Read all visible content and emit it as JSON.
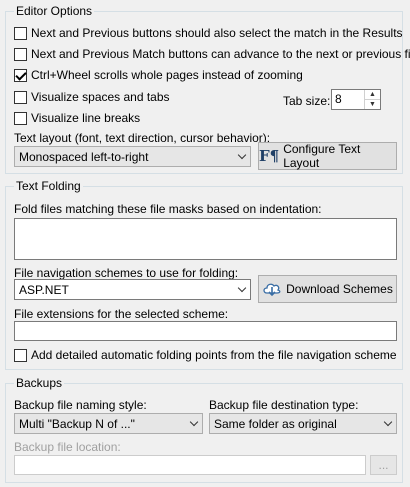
{
  "editor_options": {
    "title": "Editor Options",
    "cb_next_prev_select": {
      "label": "Next and Previous buttons should also select the match in the Results",
      "checked": false
    },
    "cb_next_prev_advance": {
      "label": "Next and Previous Match buttons can advance to the next or previous file",
      "checked": false
    },
    "cb_ctrl_wheel": {
      "label": "Ctrl+Wheel scrolls whole pages instead of zooming",
      "checked": true
    },
    "cb_visualize_spaces": {
      "label": "Visualize spaces and tabs",
      "checked": false
    },
    "cb_visualize_linebreaks": {
      "label": "Visualize line breaks",
      "checked": false
    },
    "tab_size_label": "Tab size:",
    "tab_size_value": "8",
    "text_layout_label": "Text layout (font, text direction, cursor behavior):",
    "text_layout_value": "Monospaced left-to-right",
    "configure_button": "Configure Text Layout"
  },
  "text_folding": {
    "title": "Text Folding",
    "masks_label": "Fold files matching these file masks based on indentation:",
    "masks_value": "",
    "schemes_label": "File navigation schemes to use for folding:",
    "schemes_value": "ASP.NET",
    "download_button": "Download Schemes",
    "extensions_label": "File extensions for the selected scheme:",
    "extensions_value": "",
    "cb_detailed": {
      "label": "Add detailed automatic folding points from the file navigation scheme",
      "checked": false
    }
  },
  "backups": {
    "title": "Backups",
    "naming_label": "Backup file naming style:",
    "naming_value": "Multi \"Backup N of ...\"",
    "destination_label": "Backup file destination type:",
    "destination_value": "Same folder as original",
    "location_label": "Backup file location:",
    "location_value": "",
    "browse_button": "..."
  },
  "icons": {
    "configure": "paragraph-font-icon",
    "download": "cloud-download-icon"
  },
  "colors": {
    "background": "#f0f0f0",
    "group_border": "#d5dfe5",
    "disabled_text": "#a0a0a0"
  }
}
